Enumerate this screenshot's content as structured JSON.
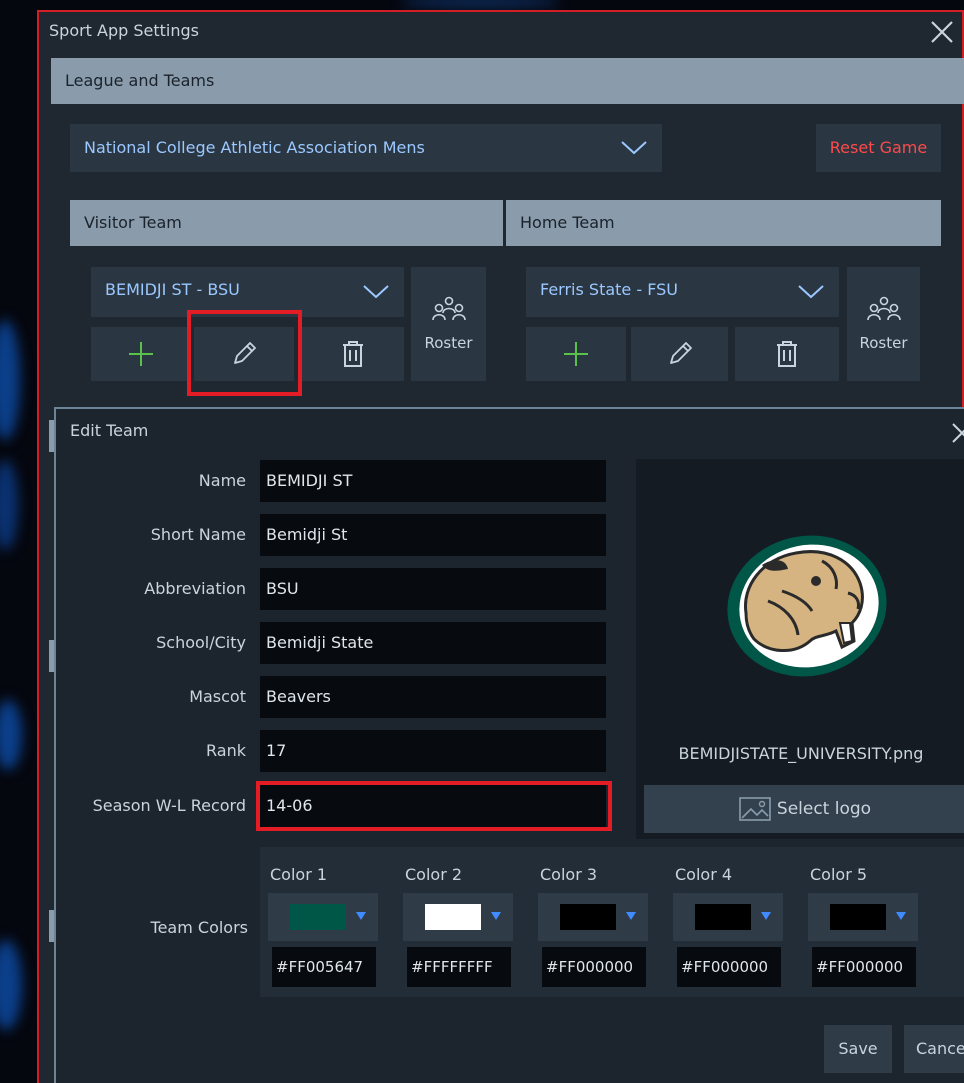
{
  "window": {
    "title": "Sport App Settings"
  },
  "league_section": {
    "header": "League and Teams",
    "league_selected": "National College Athletic Association Mens",
    "reset_label": "Reset Game"
  },
  "visitor": {
    "header": "Visitor Team",
    "team_selected": "BEMIDJI ST - BSU",
    "roster_label": "Roster"
  },
  "home": {
    "header": "Home Team",
    "team_selected": "Ferris State - FSU",
    "roster_label": "Roster"
  },
  "edit_team": {
    "title": "Edit Team",
    "fields": [
      {
        "label": "Name",
        "value": "BEMIDJI ST"
      },
      {
        "label": "Short Name",
        "value": "Bemidji St"
      },
      {
        "label": "Abbreviation",
        "value": "BSU"
      },
      {
        "label": "School/City",
        "value": "Bemidji State"
      },
      {
        "label": "Mascot",
        "value": "Beavers"
      },
      {
        "label": "Rank",
        "value": "17"
      },
      {
        "label": "Season W-L Record",
        "value": "14-06"
      }
    ],
    "logo_filename": "BEMIDJISTATE_UNIVERSITY.png",
    "select_logo_label": "Select logo",
    "team_colors_label": "Team Colors",
    "colors": [
      {
        "label": "Color 1",
        "hex": "#FF005647",
        "swatch": "#005647"
      },
      {
        "label": "Color 2",
        "hex": "#FFFFFFFF",
        "swatch": "#FFFFFF"
      },
      {
        "label": "Color 3",
        "hex": "#FF000000",
        "swatch": "#000000"
      },
      {
        "label": "Color 4",
        "hex": "#FF000000",
        "swatch": "#000000"
      },
      {
        "label": "Color 5",
        "hex": "#FF000000",
        "swatch": "#000000"
      }
    ],
    "save_label": "Save",
    "cancel_label": "Cance"
  },
  "theme": {
    "accent_text": "#9bc8ff",
    "danger": "#ff4a4a",
    "add_icon": "#58c24a",
    "highlight": "#e31c25"
  }
}
